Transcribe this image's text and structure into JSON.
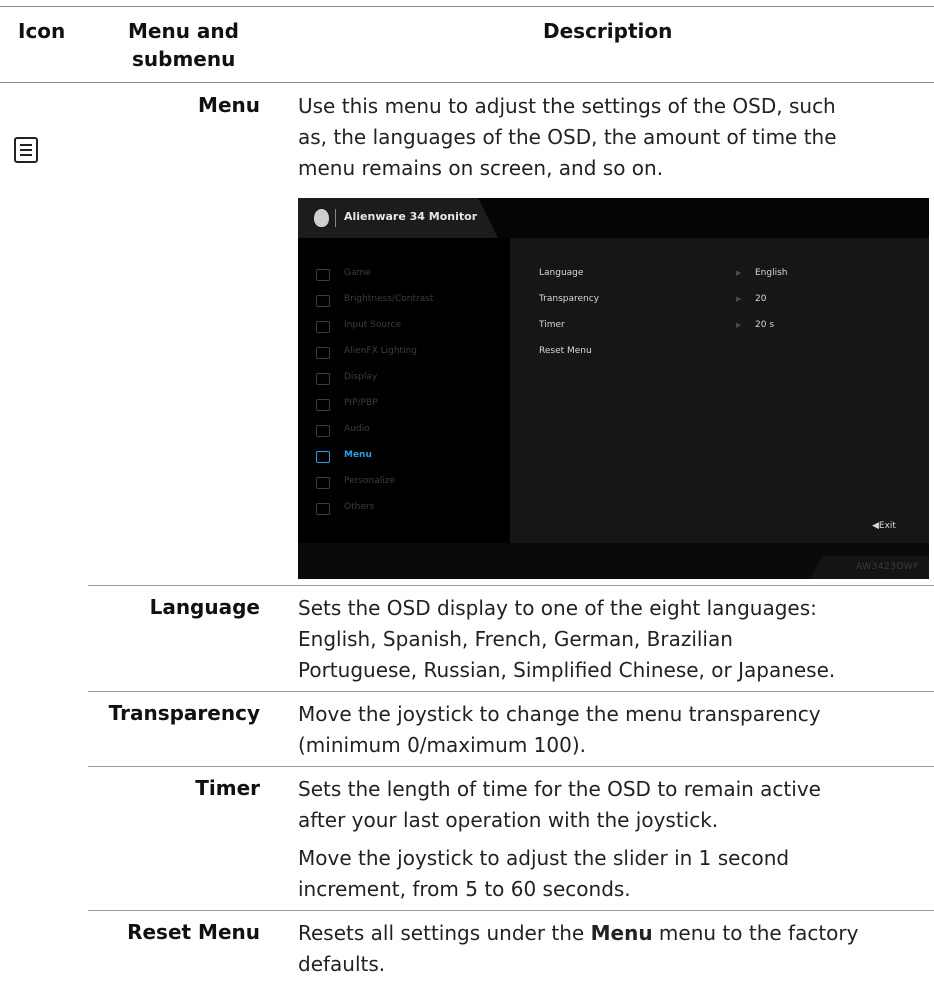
{
  "table": {
    "headers": {
      "icon": "Icon",
      "menu_line1": "Menu and",
      "menu_line2": "submenu",
      "description": "Description"
    },
    "rows": [
      {
        "icon": "menu-list-icon",
        "name": "Menu",
        "description": [
          "Use this menu to adjust the settings of the OSD, such",
          "as, the languages of the OSD, the amount of time the",
          "menu remains on screen, and so on."
        ]
      },
      {
        "name": "Language",
        "description": [
          "Sets the OSD display to one of the eight languages:",
          "English, Spanish, French, German, Brazilian",
          "Portuguese, Russian, Simplified Chinese, or Japanese."
        ]
      },
      {
        "name": "Transparency",
        "description": [
          "Move the joystick to change the menu transparency",
          "(minimum 0/maximum 100)."
        ]
      },
      {
        "name": "Timer",
        "description": [
          "Sets the length of time for the OSD to remain active",
          "after your last operation with the joystick."
        ],
        "description2": [
          "Move the joystick to adjust the slider in 1 second",
          "increment, from 5 to 60 seconds."
        ]
      },
      {
        "name": "Reset Menu",
        "description_pre": "Resets all settings under the ",
        "description_bold": "Menu",
        "description_post": " menu to the factory",
        "description_line2": "defaults."
      }
    ]
  },
  "osd": {
    "title": "Alienware 34 Monitor",
    "model": "AW3423DWF",
    "nav": [
      {
        "label": "Game",
        "icon": "gamepad-icon"
      },
      {
        "label": "Brightness/Contrast",
        "icon": "brightness-icon"
      },
      {
        "label": "Input Source",
        "icon": "input-source-icon"
      },
      {
        "label": "AlienFX Lighting",
        "icon": "fx-icon"
      },
      {
        "label": "Display",
        "icon": "display-icon"
      },
      {
        "label": "PIP/PBP",
        "icon": "pip-icon"
      },
      {
        "label": "Audio",
        "icon": "speaker-icon"
      },
      {
        "label": "Menu",
        "icon": "menu-list-icon",
        "active": true
      },
      {
        "label": "Personalize",
        "icon": "star-icon"
      },
      {
        "label": "Others",
        "icon": "others-icon"
      }
    ],
    "options": [
      {
        "label": "Language",
        "value": "English"
      },
      {
        "label": "Transparency",
        "value": "20"
      },
      {
        "label": "Timer",
        "value": "20 s"
      },
      {
        "label": "Reset Menu",
        "value": ""
      }
    ],
    "exit": "◀Exit",
    "accent": "#2a9fe0"
  }
}
